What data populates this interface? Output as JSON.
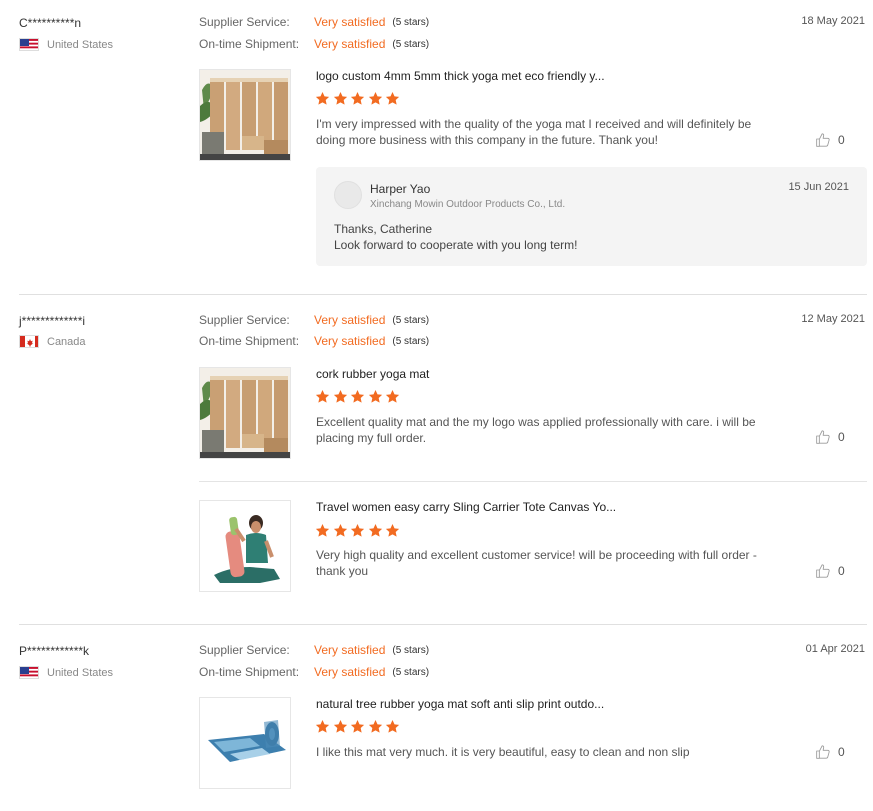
{
  "colors": {
    "accent": "#f26b21",
    "star": "#f26b21",
    "divider": "#e0e0e0",
    "reply_bg": "#f4f4f4"
  },
  "labels": {
    "supplier_service": "Supplier Service:",
    "on_time_shipment": "On-time Shipment:"
  },
  "reviews": [
    {
      "buyer": "C**********n",
      "country": "United States",
      "flag": "us-flag",
      "date": "18 May 2021",
      "supplier_service": {
        "value": "Very satisfied",
        "stars": "(5 stars)"
      },
      "on_time_shipment": {
        "value": "Very satisfied",
        "stars": "(5 stars)"
      },
      "products": [
        {
          "title": "logo custom 4mm 5mm thick yoga met eco friendly y...",
          "rating": 5,
          "text": "I'm very impressed with the quality of the yoga mat I received and will definitely be doing more business with this company in the future. Thank you!",
          "likes": "0",
          "image": "cork-yoga-mats-photo"
        }
      ],
      "reply": {
        "name": "Harper Yao",
        "company": "Xinchang Mowin Outdoor Products Co., Ltd.",
        "date": "15 Jun 2021",
        "line1": "Thanks, Catherine",
        "line2": "Look forward to cooperate with you long term!"
      }
    },
    {
      "buyer": "j*************i",
      "country": "Canada",
      "flag": "ca-flag",
      "date": "12 May 2021",
      "supplier_service": {
        "value": "Very satisfied",
        "stars": "(5 stars)"
      },
      "on_time_shipment": {
        "value": "Very satisfied",
        "stars": "(5 stars)"
      },
      "products": [
        {
          "title": "cork rubber yoga mat",
          "rating": 5,
          "text": "Excellent quality mat and the my logo was applied professionally with care. i will be placing my full order.",
          "likes": "0",
          "image": "cork-yoga-mats-photo"
        },
        {
          "title": "Travel women easy carry Sling Carrier Tote Canvas Yo...",
          "rating": 5,
          "text": "Very high quality and excellent customer service! will be proceeding with full order - thank you",
          "likes": "0",
          "image": "yoga-bag-woman-photo"
        }
      ]
    },
    {
      "buyer": "P************k",
      "country": "United States",
      "flag": "us-flag",
      "date": "01 Apr 2021",
      "supplier_service": {
        "value": "Very satisfied",
        "stars": "(5 stars)"
      },
      "on_time_shipment": {
        "value": "Very satisfied",
        "stars": "(5 stars)"
      },
      "products": [
        {
          "title": "natural tree rubber yoga mat soft anti slip print outdo...",
          "rating": 5,
          "text": "I like this mat very much. it is very beautiful, easy to clean and non slip",
          "likes": "0",
          "image": "blue-yoga-mat-photo"
        }
      ]
    }
  ]
}
